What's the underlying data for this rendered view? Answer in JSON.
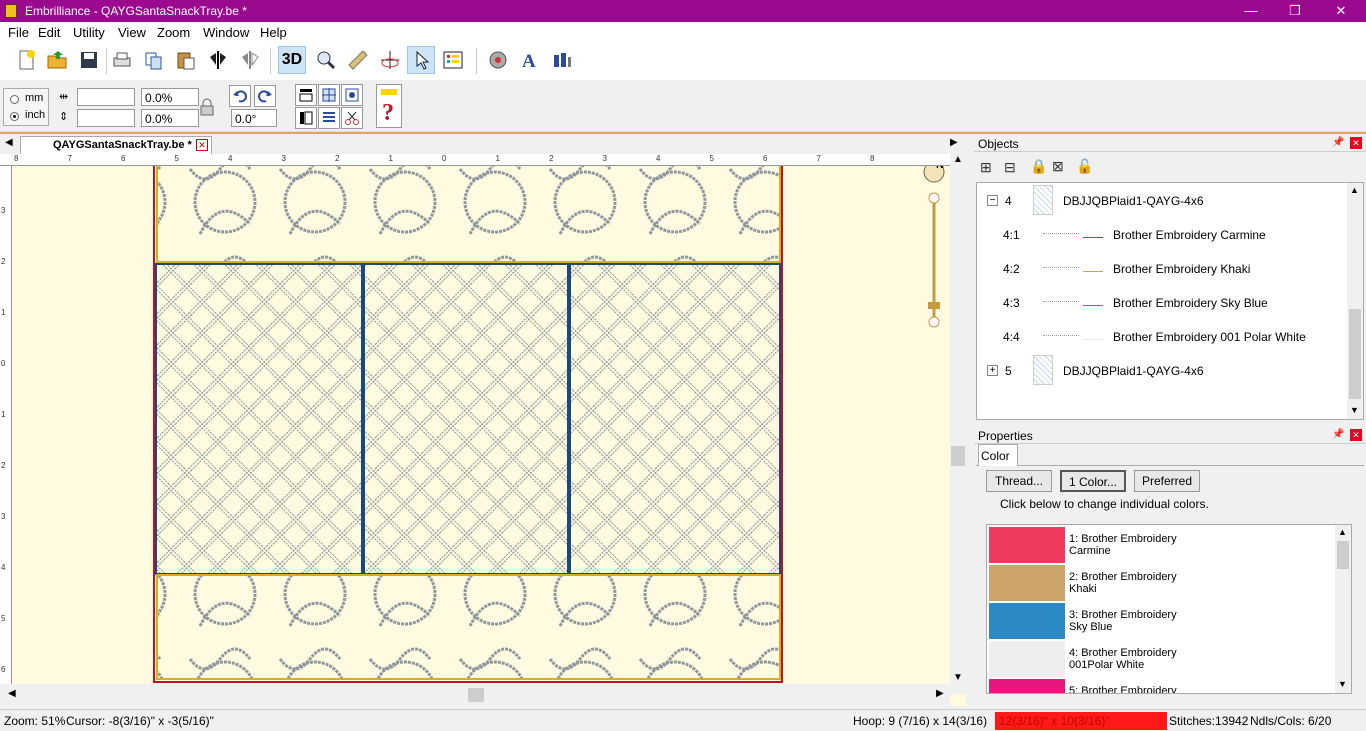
{
  "window": {
    "app_name": "Embrilliance",
    "separator": " - ",
    "doc_title": "QAYGSantaSnackTray.be *"
  },
  "menu": [
    "File",
    "Edit",
    "Utility",
    "View",
    "Zoom",
    "Window",
    "Help"
  ],
  "toolbar": {
    "three_d_label": "3D"
  },
  "toolbar2": {
    "unit_mm": "mm",
    "unit_inch": "inch",
    "width_value": "",
    "height_value": "",
    "width_pct": "0.0%",
    "height_pct": "0.0%",
    "rotation": "0.0°"
  },
  "doc_tab": {
    "label": "QAYGSantaSnackTray.be *"
  },
  "ruler": {
    "top_labels": [
      "8",
      "7",
      "6",
      "5",
      "4",
      "3",
      "2",
      "1",
      "0",
      "1",
      "2",
      "3",
      "4",
      "5",
      "6",
      "7",
      "8"
    ],
    "left_labels": [
      "3",
      "2",
      "1",
      "0",
      "1",
      "2",
      "3",
      "4",
      "5",
      "6"
    ]
  },
  "objects_panel": {
    "title": "Objects",
    "items": [
      {
        "index": "4",
        "label": "DBJJQBPlaid1-QAYG-4x6",
        "expander": "−"
      },
      {
        "index": "4:1",
        "label": "Brother Embroidery Carmine",
        "line_color": "#e0284f"
      },
      {
        "index": "4:2",
        "label": "Brother Embroidery Khaki",
        "line_color": "#c9a46a"
      },
      {
        "index": "4:3",
        "label": "Brother Embroidery Sky Blue",
        "line_color": "#2a86c0"
      },
      {
        "index": "4:4",
        "label": "Brother Embroidery 001 Polar White",
        "line_color": "#e8e8e8"
      },
      {
        "index": "5",
        "label": "DBJJQBPlaid1-QAYG-4x6",
        "expander": "+"
      }
    ]
  },
  "properties_panel": {
    "title": "Properties",
    "tab": "Color",
    "buttons": {
      "thread": "Thread...",
      "one_color": "1 Color...",
      "preferred": "Preferred"
    },
    "hint": "Click below to change individual colors.",
    "colors": [
      {
        "line1": "1: Brother Embroidery",
        "line2": "Carmine",
        "hex": "#f03a60"
      },
      {
        "line1": "2: Brother Embroidery",
        "line2": "Khaki",
        "hex": "#cca468"
      },
      {
        "line1": "3: Brother Embroidery",
        "line2": "Sky Blue",
        "hex": "#2b8ac4"
      },
      {
        "line1": "4: Brother Embroidery",
        "line2": "001Polar White",
        "hex": "#eeeeee"
      },
      {
        "line1": "5: Brother Embroidery",
        "line2": "",
        "hex": "#e8177e"
      }
    ]
  },
  "status": {
    "zoom": "Zoom: 51%",
    "cursor": "Cursor: -8(3/16)\" x -3(5/16)\"",
    "hoop": "Hoop: 9 (7/16) x 14(3/16)",
    "size": "12(3/16)\" x 10(3/16)\"",
    "stitches": "Stitches:13942",
    "ndls": "Ndls/Cols: 6/20",
    "size_bg": "#ff1a1a"
  },
  "colors": {
    "title_bar": "#9b0a8e",
    "canvas_bg": "#fffbe0",
    "grid_stitch": "#9aa0a8",
    "hoop_border": "#c0102a"
  }
}
